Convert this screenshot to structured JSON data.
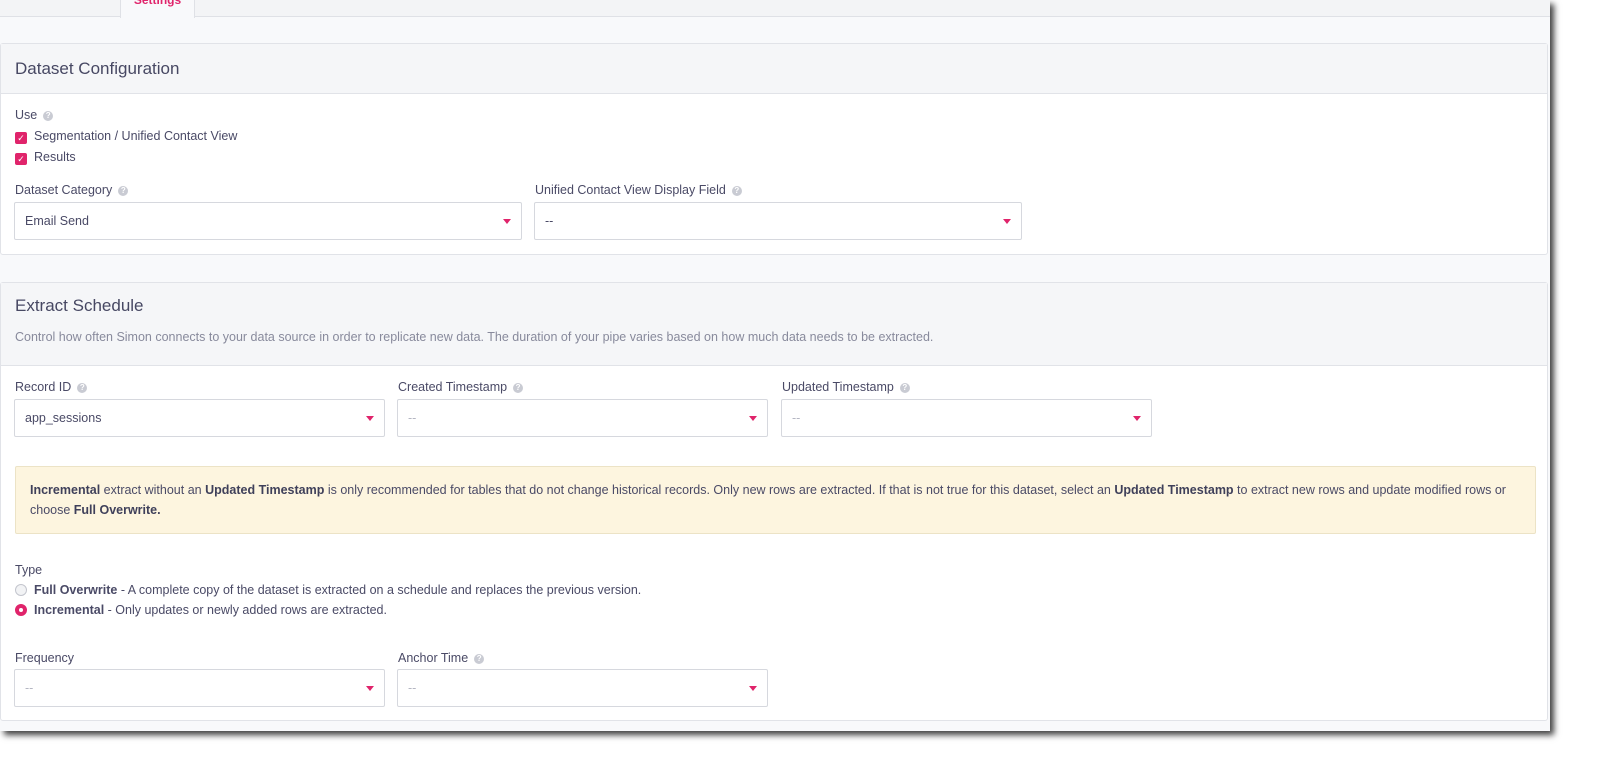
{
  "tabs": {
    "active": "Settings"
  },
  "dataset_config": {
    "title": "Dataset Configuration",
    "use_label": "Use",
    "use_options": [
      {
        "label": "Segmentation / Unified Contact View",
        "checked": true
      },
      {
        "label": "Results",
        "checked": true
      }
    ],
    "category_label": "Dataset Category",
    "category_value": "Email Send",
    "display_field_label": "Unified Contact View Display Field",
    "display_field_value": "--"
  },
  "extract_schedule": {
    "title": "Extract Schedule",
    "description": "Control how often Simon connects to your data source in order to replicate new data. The duration of your pipe varies based on how much data needs to be extracted.",
    "record_id_label": "Record ID",
    "record_id_value": "app_sessions",
    "created_label": "Created Timestamp",
    "created_value": "--",
    "updated_label": "Updated Timestamp",
    "updated_value": "--",
    "alert": {
      "b1": "Incremental",
      "t1": " extract without an ",
      "b2": "Updated Timestamp",
      "t2": " is only recommended for tables that do not change historical records. Only new rows are extracted. If that is not true for this dataset, select an ",
      "b3": "Updated Timestamp",
      "t3": " to extract new rows and update modified rows or choose ",
      "b4": "Full Overwrite."
    },
    "type_label": "Type",
    "types": [
      {
        "name": "Full Overwrite",
        "desc": " - A complete copy of the dataset is extracted on a schedule and replaces the previous version.",
        "selected": false
      },
      {
        "name": "Incremental",
        "desc": " - Only updates or newly added rows are extracted.",
        "selected": true
      }
    ],
    "frequency_label": "Frequency",
    "frequency_value": "--",
    "anchor_label": "Anchor Time",
    "anchor_value": "--"
  },
  "colors": {
    "accent": "#e0246b",
    "alert_bg": "#fdf5df"
  },
  "icons": {
    "help": "question-circle-icon",
    "caret": "caret-down-icon",
    "check": "checkmark-icon"
  }
}
